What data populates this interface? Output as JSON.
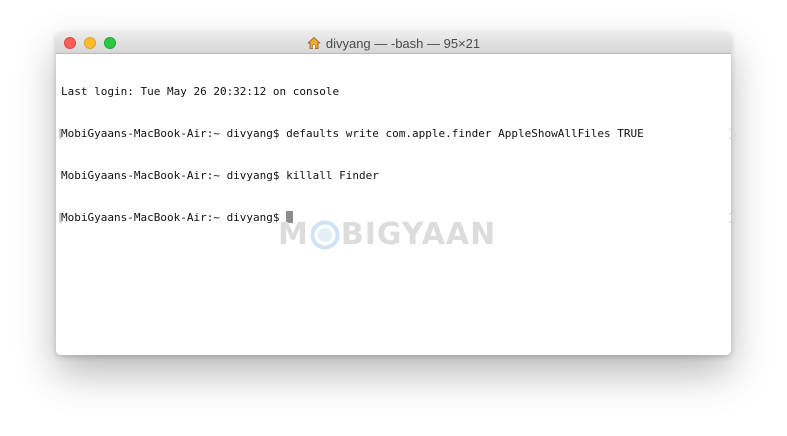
{
  "window": {
    "title": "divyang — -bash — 95×21",
    "title_icon": "home-icon"
  },
  "terminal": {
    "lines": [
      {
        "prompt": "",
        "command": "Last login: Tue May 26 20:32:12 on console",
        "left_mark": "",
        "right_mark": ""
      },
      {
        "prompt": "MobiGyaans-MacBook-Air:~ divyang$ ",
        "command": "defaults write com.apple.finder AppleShowAllFiles TRUE",
        "left_mark": "[",
        "right_mark": "]"
      },
      {
        "prompt": "MobiGyaans-MacBook-Air:~ divyang$ ",
        "command": "killall Finder",
        "left_mark": "",
        "right_mark": ""
      },
      {
        "prompt": "MobiGyaans-MacBook-Air:~ divyang$ ",
        "command": "",
        "left_mark": "[",
        "right_mark": "]"
      }
    ]
  },
  "watermark": {
    "part1": "M",
    "part2": "BIGYAAN"
  },
  "colors": {
    "close": "#fc5f57",
    "minimize": "#fdbc2e",
    "zoom": "#28c840",
    "cursor": "#8c8c8c"
  }
}
